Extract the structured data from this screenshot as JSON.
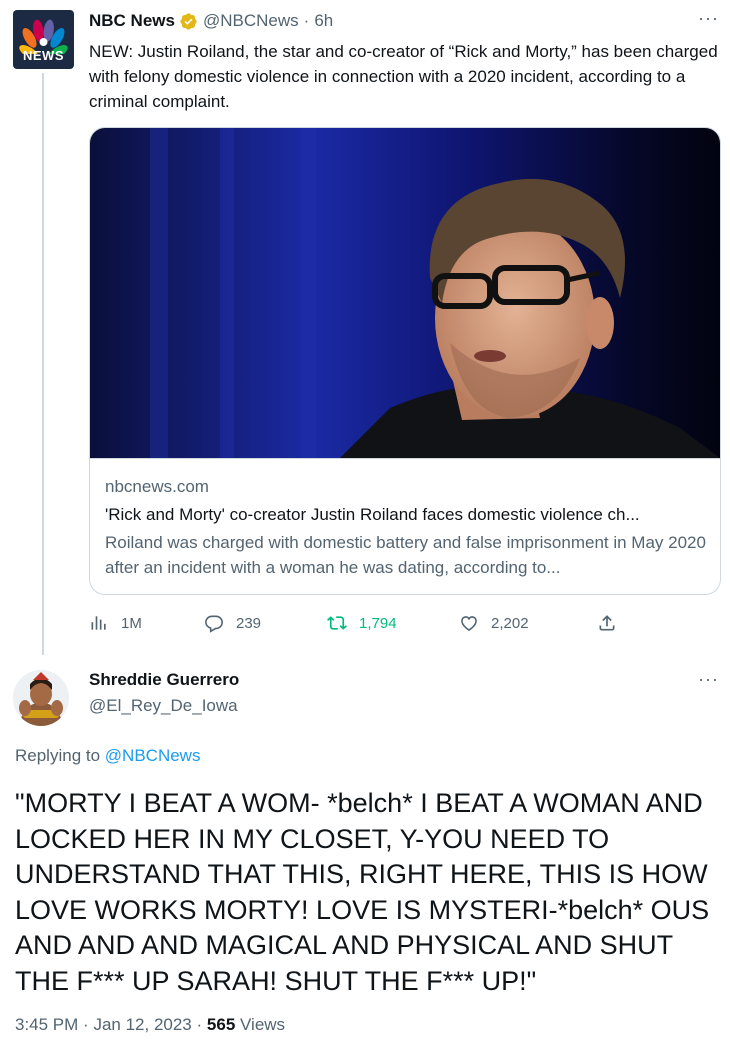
{
  "parent_tweet": {
    "author_name": "NBC News",
    "avatar_label": "NEWS",
    "handle": "@NBCNews",
    "separator": "·",
    "time": "6h",
    "text": "NEW: Justin Roiland, the star and co-creator of “Rick and Morty,” has been charged with felony domestic violence in connection with a 2020 incident, according to a criminal complaint.",
    "card": {
      "domain": "nbcnews.com",
      "title": "'Rick and Morty' co-creator Justin Roiland faces domestic violence ch...",
      "description": "Roiland was charged with domestic battery and false imprisonment in May 2020 after an incident with a woman he was dating, according to..."
    },
    "actions": {
      "views": "1M",
      "replies": "239",
      "retweets": "1,794",
      "likes": "2,202"
    }
  },
  "reply_tweet": {
    "author_name": "Shreddie Guerrero",
    "handle": "@El_Rey_De_Iowa",
    "replying_prefix": "Replying to",
    "replying_to": "@NBCNews",
    "text": "\"MORTY I BEAT A WOM- *belch* I BEAT A WOMAN AND LOCKED HER IN MY CLOSET, Y-YOU NEED TO UNDERSTAND THAT THIS, RIGHT HERE, THIS IS HOW LOVE WORKS MORTY! LOVE IS MYSTERI-*belch* OUS AND AND AND MAGICAL AND PHYSICAL AND SHUT THE F*** UP SARAH! SHUT THE F*** UP!\"",
    "time": "3:45 PM",
    "date": "Jan 12, 2023",
    "views_count": "565",
    "views_label": "Views",
    "separator": "·"
  },
  "icons": {
    "verified": "verified-badge-icon",
    "more": "more-dots-icon",
    "views": "bar-chart-icon",
    "reply": "speech-bubble-icon",
    "retweet": "retweet-icon",
    "like": "heart-icon",
    "share": "share-icon"
  },
  "colors": {
    "text": "#0f1419",
    "muted": "#536471",
    "link": "#1d9bf0",
    "retweet_green": "#00ba7c",
    "verified_gold": "#e2b719",
    "border": "#cfd9de",
    "nbc_avatar_bg": "#1d2a44"
  },
  "more_glyph": "···"
}
